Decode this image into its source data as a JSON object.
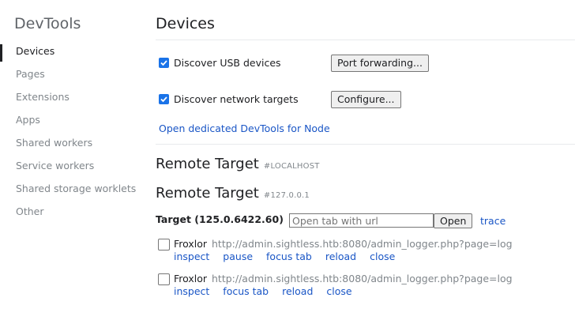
{
  "app_title": "DevTools",
  "nav": [
    {
      "label": "Devices",
      "selected": true
    },
    {
      "label": "Pages"
    },
    {
      "label": "Extensions"
    },
    {
      "label": "Apps"
    },
    {
      "label": "Shared workers"
    },
    {
      "label": "Service workers"
    },
    {
      "label": "Shared storage worklets"
    },
    {
      "label": "Other"
    }
  ],
  "page_title": "Devices",
  "options": {
    "usb_label": "Discover USB devices",
    "usb_checked": true,
    "port_forwarding_button": "Port forwarding...",
    "network_label": "Discover network targets",
    "network_checked": true,
    "configure_button": "Configure...",
    "node_link": "Open dedicated DevTools for Node"
  },
  "remote_targets": [
    {
      "title": "Remote Target",
      "host": "#LOCALHOST"
    },
    {
      "title": "Remote Target",
      "host": "#127.0.0.1"
    }
  ],
  "target": {
    "name": "Target (125.0.6422.60)",
    "input_placeholder": "Open tab with url",
    "open_button": "Open",
    "trace_link": "trace"
  },
  "tabs": [
    {
      "title": "Froxlor",
      "url": "http://admin.sightless.htb:8080/admin_logger.php?page=log",
      "actions": [
        "inspect",
        "pause",
        "focus tab",
        "reload",
        "close"
      ]
    },
    {
      "title": "Froxlor",
      "url": "http://admin.sightless.htb:8080/admin_logger.php?page=log",
      "actions": [
        "inspect",
        "focus tab",
        "reload",
        "close"
      ]
    }
  ],
  "colors": {
    "accent": "#1a73e8",
    "link": "#1a56c6",
    "muted": "#80868b"
  }
}
